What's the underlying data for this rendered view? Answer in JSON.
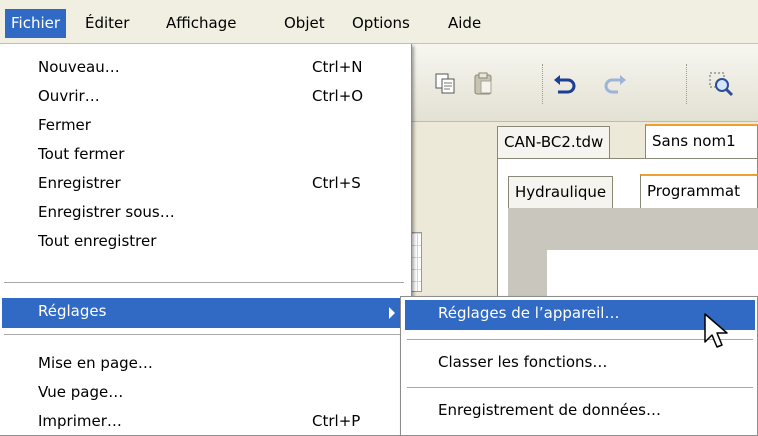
{
  "menubar": {
    "items": [
      {
        "label": "Fichier"
      },
      {
        "label": "Éditer"
      },
      {
        "label": "Affichage"
      },
      {
        "label": "Objet"
      },
      {
        "label": "Options"
      },
      {
        "label": "Aide"
      }
    ]
  },
  "toolbar": {
    "icons": [
      "copy-icon",
      "paste-icon",
      "undo-icon",
      "redo-icon",
      "zoom-icon"
    ]
  },
  "tabs": {
    "documents": [
      {
        "label": "CAN-BC2.tdw"
      },
      {
        "label": "Sans nom1"
      }
    ],
    "views": [
      {
        "label": "Hydraulique"
      },
      {
        "label": "Programmat"
      }
    ]
  },
  "file_menu": {
    "items": [
      {
        "label": "Nouveau…",
        "shortcut": "Ctrl+N"
      },
      {
        "label": "Ouvrir…",
        "shortcut": "Ctrl+O"
      },
      {
        "label": "Fermer",
        "shortcut": ""
      },
      {
        "label": "Tout fermer",
        "shortcut": ""
      },
      {
        "label": "Enregistrer",
        "shortcut": "Ctrl+S"
      },
      {
        "label": "Enregistrer sous…",
        "shortcut": ""
      },
      {
        "label": "Tout enregistrer",
        "shortcut": ""
      },
      {
        "label": "Réglages",
        "shortcut": ""
      },
      {
        "label": "Mise en page…",
        "shortcut": ""
      },
      {
        "label": "Vue page…",
        "shortcut": ""
      },
      {
        "label": "Imprimer…",
        "shortcut": "Ctrl+P"
      }
    ]
  },
  "settings_submenu": {
    "items": [
      {
        "label": "Réglages de l’appareil…"
      },
      {
        "label": "Classer les fonctions…"
      },
      {
        "label": "Enregistrement de données…"
      }
    ]
  },
  "colors": {
    "highlight": "#316ac5",
    "menu_bg": "#ffffff",
    "active_tab_accent": "#f0a030"
  }
}
